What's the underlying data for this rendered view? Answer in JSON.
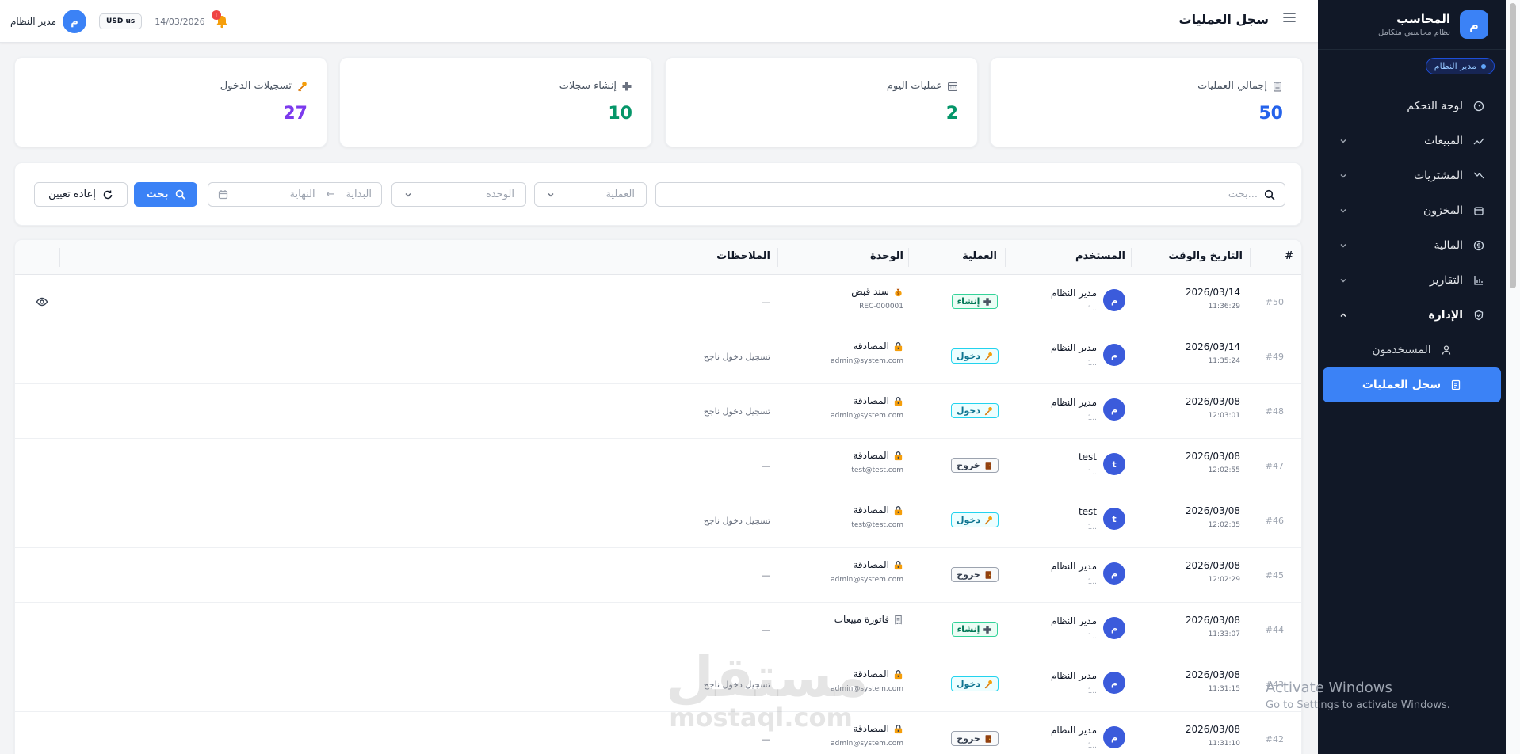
{
  "sidebar": {
    "brand_title": "المحاسب",
    "brand_subtitle": "نظام محاسبي متكامل",
    "brand_logo": "م",
    "role_badge": "مدير النظام",
    "items": [
      {
        "label": "لوحة التحكم",
        "icon": "dashboard-icon",
        "chevron": ""
      },
      {
        "label": "المبيعات",
        "icon": "trend-up-icon",
        "chevron": "down"
      },
      {
        "label": "المشتريات",
        "icon": "trend-down-icon",
        "chevron": "down"
      },
      {
        "label": "المخزون",
        "icon": "box-icon",
        "chevron": "down"
      },
      {
        "label": "المالية",
        "icon": "dollar-icon",
        "chevron": "down"
      },
      {
        "label": "التقارير",
        "icon": "chart-icon",
        "chevron": "down"
      },
      {
        "label": "الإدارة",
        "icon": "shield-icon",
        "chevron": "up"
      }
    ],
    "sub_items": [
      {
        "label": "المستخدمون",
        "icon": "user-icon"
      },
      {
        "label": "سجل العمليات",
        "icon": "log-icon"
      }
    ]
  },
  "topbar": {
    "title": "سجل العمليات",
    "user_name": "مدير النظام",
    "avatar": "م",
    "currency": "USD us",
    "date": "14/03/2026",
    "notifications": "1"
  },
  "stats": [
    {
      "label": "إجمالي العمليات",
      "value": "50",
      "color": "#2563eb",
      "icon": "clipboard-icon"
    },
    {
      "label": "عمليات اليوم",
      "value": "2",
      "color": "#059669",
      "icon": "calendar-icon"
    },
    {
      "label": "إنشاء سجلات",
      "value": "10",
      "color": "#059669",
      "icon": "plus-icon"
    },
    {
      "label": "تسجيلات الدخول",
      "value": "27",
      "color": "#7c3aed",
      "icon": "key-icon"
    }
  ],
  "filters": {
    "search_placeholder": "بحث...",
    "operation_placeholder": "العملية",
    "unit_placeholder": "الوحدة",
    "start_placeholder": "البداية",
    "end_placeholder": "النهاية",
    "arrow": "←",
    "search_button": "بحث",
    "reset_button": "إعادة تعيين"
  },
  "table": {
    "headers": {
      "index": "#",
      "datetime": "التاريخ والوقت",
      "user": "المستخدم",
      "operation": "العملية",
      "unit": "الوحدة",
      "notes": "الملاحظات"
    },
    "rows": [
      {
        "index": "#50",
        "date": "2026/03/14",
        "time": "11:36:29",
        "user": "مدير النظام",
        "avatar": "م",
        "user_sub": "1..",
        "op": "إنشاء",
        "op_type": "create",
        "unit": "سند قبض",
        "unit_icon": "money-bag-icon",
        "unit_sub": "REC-000001",
        "note": "—",
        "action": true
      },
      {
        "index": "#49",
        "date": "2026/03/14",
        "time": "11:35:24",
        "user": "مدير النظام",
        "avatar": "م",
        "user_sub": "1..",
        "op": "دخول",
        "op_type": "login",
        "unit": "المصادقة",
        "unit_icon": "lock-icon",
        "unit_sub": "admin@system.com",
        "note": "تسجيل دخول ناجح",
        "action": false
      },
      {
        "index": "#48",
        "date": "2026/03/08",
        "time": "12:03:01",
        "user": "مدير النظام",
        "avatar": "م",
        "user_sub": "1..",
        "op": "دخول",
        "op_type": "login",
        "unit": "المصادقة",
        "unit_icon": "lock-icon",
        "unit_sub": "admin@system.com",
        "note": "تسجيل دخول ناجح",
        "action": false
      },
      {
        "index": "#47",
        "date": "2026/03/08",
        "time": "12:02:55",
        "user": "test",
        "avatar": "t",
        "user_sub": "1..",
        "op": "خروج",
        "op_type": "logout",
        "unit": "المصادقة",
        "unit_icon": "lock-icon",
        "unit_sub": "test@test.com",
        "note": "—",
        "action": false
      },
      {
        "index": "#46",
        "date": "2026/03/08",
        "time": "12:02:35",
        "user": "test",
        "avatar": "t",
        "user_sub": "1..",
        "op": "دخول",
        "op_type": "login",
        "unit": "المصادقة",
        "unit_icon": "lock-icon",
        "unit_sub": "test@test.com",
        "note": "تسجيل دخول ناجح",
        "action": false
      },
      {
        "index": "#45",
        "date": "2026/03/08",
        "time": "12:02:29",
        "user": "مدير النظام",
        "avatar": "م",
        "user_sub": "1..",
        "op": "خروج",
        "op_type": "logout",
        "unit": "المصادقة",
        "unit_icon": "lock-icon",
        "unit_sub": "admin@system.com",
        "note": "—",
        "action": false
      },
      {
        "index": "#44",
        "date": "2026/03/08",
        "time": "11:33:07",
        "user": "مدير النظام",
        "avatar": "م",
        "user_sub": "1..",
        "op": "إنشاء",
        "op_type": "create",
        "unit": "فاتورة مبيعات",
        "unit_icon": "receipt-icon",
        "unit_sub": "",
        "note": "—",
        "action": false
      },
      {
        "index": "#43",
        "date": "2026/03/08",
        "time": "11:31:15",
        "user": "مدير النظام",
        "avatar": "م",
        "user_sub": "1..",
        "op": "دخول",
        "op_type": "login",
        "unit": "المصادقة",
        "unit_icon": "lock-icon",
        "unit_sub": "admin@system.com",
        "note": "تسجيل دخول ناجح",
        "action": false
      },
      {
        "index": "#42",
        "date": "2026/03/08",
        "time": "11:31:10",
        "user": "مدير النظام",
        "avatar": "م",
        "user_sub": "1..",
        "op": "خروج",
        "op_type": "logout",
        "unit": "المصادقة",
        "unit_icon": "lock-icon",
        "unit_sub": "admin@system.com",
        "note": "—",
        "action": false
      }
    ]
  },
  "watermark": {
    "arabic": "مستقل",
    "latin": "mostaql.com"
  },
  "os_notice": {
    "line1": "Activate Windows",
    "line2": "Go to Settings to activate Windows."
  }
}
